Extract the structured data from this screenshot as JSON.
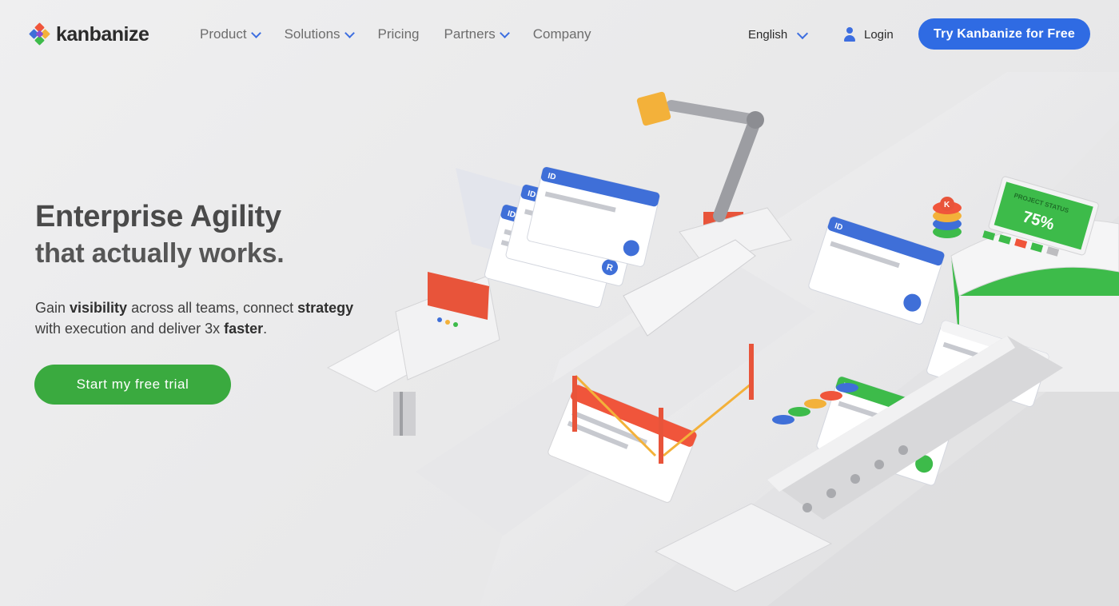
{
  "header": {
    "logo_text": "kanbanize",
    "nav": [
      {
        "label": "Product",
        "has_dropdown": true
      },
      {
        "label": "Solutions",
        "has_dropdown": true
      },
      {
        "label": "Pricing",
        "has_dropdown": false
      },
      {
        "label": "Partners",
        "has_dropdown": true
      },
      {
        "label": "Company",
        "has_dropdown": false
      }
    ],
    "language": "English",
    "login": "Login",
    "cta": "Try Kanbanize for Free"
  },
  "hero": {
    "title": "Enterprise Agility",
    "subtitle": "that actually works.",
    "desc_parts": [
      {
        "text": "Gain ",
        "bold": false
      },
      {
        "text": "visibility",
        "bold": true
      },
      {
        "text": " across all teams, connect ",
        "bold": false
      },
      {
        "text": "strategy",
        "bold": true
      },
      {
        "text": "with execution and deliver 3x ",
        "bold": false
      },
      {
        "text": "faster",
        "bold": true
      },
      {
        "text": ".",
        "bold": false
      }
    ],
    "cta": "Start my free trial"
  },
  "illustration": {
    "project_status_label": "PROJECT STATUS",
    "project_status_value": "75%",
    "card_id_label": "ID",
    "card_avatar_letter": "R",
    "chip_letter": "K"
  },
  "colors": {
    "brand_blue": "#2f6be3",
    "brand_green": "#3aaa3f",
    "card_blue": "#3f6fd8",
    "card_red": "#f0553b",
    "card_green": "#3dbb4a",
    "accent_yellow": "#f3b13a"
  }
}
